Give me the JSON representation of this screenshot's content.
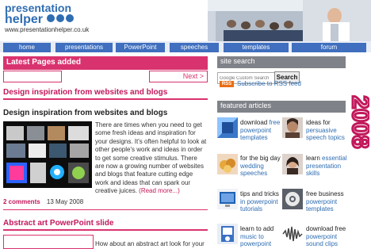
{
  "header": {
    "logo_line1": "presentation",
    "logo_line2": "helper",
    "url": "www.presentationhelper.co.uk"
  },
  "nav": [
    "home",
    "presentations",
    "PowerPoint",
    "speeches",
    "templates",
    "forum"
  ],
  "latest": {
    "heading": "Latest Pages added",
    "next": "Next >"
  },
  "post1": {
    "title": "Design inspiration from websites and blogs",
    "subtitle": "Design inspiration from websites and blogs",
    "body": "There are times when you need to get some fresh ideas and inspiration for your designs. It's often helpful to look at other people's work and ideas in order to get some creative stimulus. There are now a growing number of websites and blogs that feature cutting edge work and ideas that can spark our creative juices.",
    "more": "(Read more...)",
    "comments": "2 comments",
    "date": "13 May 2008"
  },
  "post2": {
    "title": "Abstract art PowerPoint slide",
    "body": "How about an abstract art look for your"
  },
  "sidebar": {
    "search_heading": "site search",
    "search_placeholder": "Google Custom Search",
    "search_button": "Search",
    "rss_badge": "RSS",
    "rss_link": "Subscribe to RSS feed",
    "featured_heading": "featured articles",
    "year": "2008",
    "featured": [
      {
        "dark": "download",
        "blue": "free powerpoint templates"
      },
      {
        "dark": "ideas for",
        "blue": "persuasive speech topics"
      },
      {
        "dark": "for the big day",
        "blue": "wedding speeches"
      },
      {
        "dark": "learn",
        "blue": "essential presentation skills"
      },
      {
        "dark": "tips and tricks",
        "blue": "in powerpoint tutorials"
      },
      {
        "dark": "free business",
        "blue": "powerpoint templates"
      },
      {
        "dark": "learn to add",
        "blue": "music to powerpoint"
      },
      {
        "dark": "download free",
        "blue": "powerpoint sound clips"
      }
    ]
  }
}
